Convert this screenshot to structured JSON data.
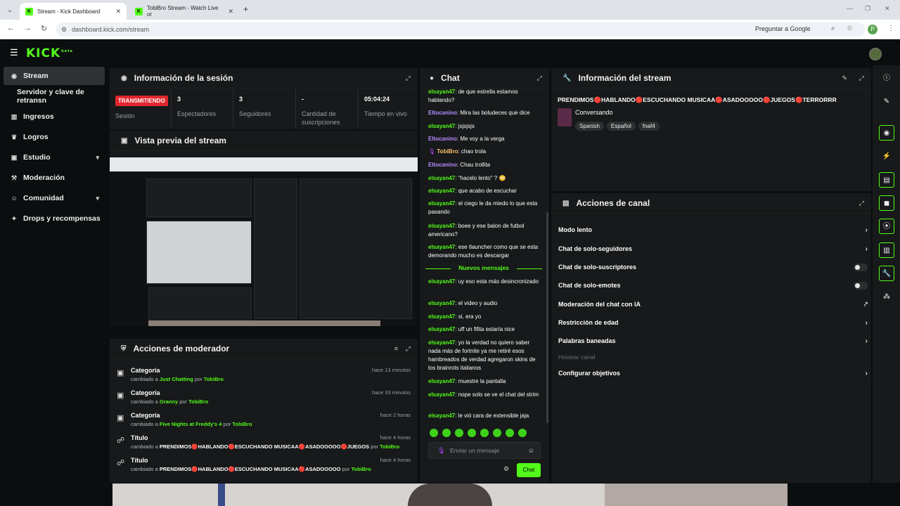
{
  "browser": {
    "tabs": [
      {
        "title": "Stream - Kick Dashboard",
        "active": true
      },
      {
        "title": "TobiBro Stream - Watch Live or",
        "active": false
      }
    ],
    "url": "dashboard.kick.com/stream",
    "ask_google": "Preguntar a Google",
    "profile_initial": "P"
  },
  "app": {
    "logo": "KICK",
    "logo_sup": "beta"
  },
  "sidebar": {
    "items": [
      {
        "label": "Stream",
        "icon": "broadcast-icon"
      },
      {
        "label": "Servidor y clave de retransn",
        "icon": ""
      },
      {
        "label": "Ingresos",
        "icon": "chart-icon"
      },
      {
        "label": "Logros",
        "icon": "trophy-icon"
      },
      {
        "label": "Estudio",
        "icon": "studio-icon"
      },
      {
        "label": "Moderación",
        "icon": "hammer-icon"
      },
      {
        "label": "Comunidad",
        "icon": "community-icon"
      },
      {
        "label": "Drops y recompensas",
        "icon": "gift-icon"
      }
    ]
  },
  "session": {
    "title": "Información de la sesión",
    "badge": "TRANSMITIENDO",
    "badge_label": "Sesión",
    "stats": [
      {
        "value": "3",
        "label": "Espectadores"
      },
      {
        "value": "3",
        "label": "Seguidores"
      },
      {
        "value": "-",
        "label": "Cantidad de suscripciones"
      },
      {
        "value": "05:04:24",
        "label": "Tiempo en vivo"
      }
    ]
  },
  "preview": {
    "title": "Vista previa del stream"
  },
  "modactions": {
    "title": "Acciones de moderador",
    "rows": [
      {
        "title": "Categoría",
        "pre": "cambiado a ",
        "value": "Just Chatting",
        "by": " por ",
        "user": "TobiBro",
        "time": "hace 13 minutos"
      },
      {
        "title": "Categoría",
        "pre": "cambiado a ",
        "value": "Granny",
        "by": " por ",
        "user": "TobiBro",
        "time": "hace 33 minutos"
      },
      {
        "title": "Categoría",
        "pre": "cambiado a ",
        "value": "Five Nights at Freddy's 4",
        "by": " por ",
        "user": "TobiBro",
        "time": "hace 2 horas"
      },
      {
        "title": "Título",
        "pre": "cambiado a ",
        "value": "PRENDIMOS🔴HABLANDO🔴ESCUCHANDO MUSICAA🔴ASADOOOOO🔴JUEGOS",
        "by": " por ",
        "user": "TobiBro",
        "time": "hace 4 horas"
      },
      {
        "title": "Título",
        "pre": "cambiado a ",
        "value": "PRENDIMOS🔴HABLANDO🔴ESCUCHANDO MUSICAA🔴ASADOOOOO",
        "by": " por ",
        "user": "TobiBro",
        "time": "hace 4 horas"
      }
    ]
  },
  "chat": {
    "title": "Chat",
    "messages": [
      {
        "user": "elsayan47",
        "text": "de que estrella estamos hablando?",
        "kind": "u"
      },
      {
        "user": "Eltocanino",
        "text": "Mira las boludeces que dice",
        "kind": "u2"
      },
      {
        "user": "elsayan47",
        "text": "jsjsjsjs",
        "kind": "u"
      },
      {
        "user": "Eltocanino",
        "text": "Me voy a la verga",
        "kind": "u2"
      },
      {
        "user": "TobiBro",
        "text": "chao trola",
        "kind": "u3"
      },
      {
        "user": "Eltocanino",
        "text": "Chau trollita",
        "kind": "u2"
      },
      {
        "user": "elsayan47",
        "text": "\"hacelo lento\" ? 😳",
        "kind": "u"
      },
      {
        "user": "elsayan47",
        "text": "que acabo de escuchar",
        "kind": "u"
      },
      {
        "user": "elsayan47",
        "text": "el ciego le da miedo lo que esta pasando",
        "kind": "u"
      },
      {
        "user": "elsayan47",
        "text": "boee y ese balon de futbol americano?",
        "kind": "u"
      },
      {
        "user": "elsayan47",
        "text": "ese tlauncher como que se esta demorando mucho es descargar",
        "kind": "u"
      },
      {
        "user": "elsayan47",
        "text": "uy eso esta más desincronizado",
        "kind": "u"
      },
      {
        "user": "elsayan47",
        "text": "el video y audio",
        "kind": "u"
      },
      {
        "user": "elsayan47",
        "text": "si, era yo",
        "kind": "u"
      },
      {
        "user": "elsayan47",
        "text": "uff un fifita estaría nice",
        "kind": "u"
      },
      {
        "user": "elsayan47",
        "text": "yo la verdad no quiero saber nada más de fortnite ya me retiré esos hambreados de verdad agregaron skins de los brainrots italianos",
        "kind": "u"
      },
      {
        "user": "elsayan47",
        "text": "muestre la pantalla",
        "kind": "u"
      },
      {
        "user": "elsayan47",
        "text": "nope solo se ve el chat del strim",
        "kind": "u"
      },
      {
        "user": "elsayan47",
        "text": "le vió cara de extensible jaja",
        "kind": "u"
      }
    ],
    "new_messages": "Nuevos mensajes",
    "input_placeholder": "Enviar un mensaje",
    "send_label": "Chat"
  },
  "streaminfo": {
    "title": "Información del stream",
    "stream_title": "PRENDIMOS🔴HABLANDO🔴ESCUCHANDO MUSICAA🔴ASADOOOOO🔴JUEGOS🔴TERRORRR",
    "category": "Conversando",
    "tags": [
      "Spanish",
      "Español",
      "fnaf4"
    ]
  },
  "channelactions": {
    "title": "Acciones de canal",
    "items": [
      {
        "label": "Modo lento",
        "control": "chevron"
      },
      {
        "label": "Chat de solo-seguidores",
        "control": "chevron"
      },
      {
        "label": "Chat de solo-suscriptores",
        "control": "toggle"
      },
      {
        "label": "Chat de solo-emotes",
        "control": "toggle"
      },
      {
        "label": "Moderación del chat con IA",
        "control": "external"
      },
      {
        "label": "Restricción de edad",
        "control": "chevron"
      },
      {
        "label": "Palabras baneadas",
        "control": "chevron"
      },
      {
        "label": "Hostear canal",
        "control": "none"
      },
      {
        "label": "Configurar objetivos",
        "control": "chevron"
      }
    ]
  },
  "colors": {
    "accent": "#53fc18",
    "live": "#e0262e",
    "panel": "#17191a",
    "bg": "#0b0e0f"
  }
}
